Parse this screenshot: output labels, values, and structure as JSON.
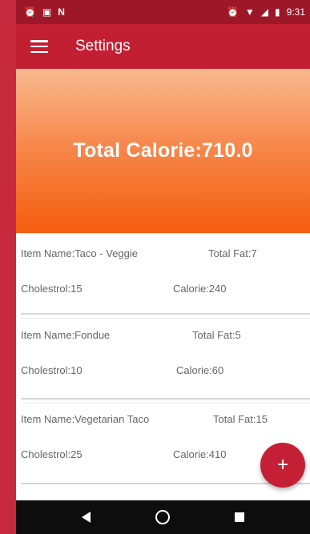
{
  "status_bar": {
    "left_icons": [
      "alarm-icon",
      "image-icon",
      "n-icon"
    ],
    "time": "9:31",
    "right_icons": [
      "alarm-icon",
      "wifi-icon",
      "signal-icon",
      "battery-icon"
    ]
  },
  "app_bar": {
    "title": "Settings",
    "menu_icon": "hamburger-menu-icon",
    "color": "#c31f33"
  },
  "banner": {
    "text": "Total Calorie:710.0",
    "gradient_colors": [
      "#f9b98f",
      "#f7894e",
      "#f45d0e"
    ]
  },
  "items": [
    {
      "name": "Item Name:Taco - Veggie",
      "fat": "Total Fat:7",
      "cholesterol": "Cholestrol:15",
      "calorie": "Calorie:240"
    },
    {
      "name": "Item Name:Fondue",
      "fat": "Total Fat:5",
      "cholesterol": "Cholestrol:10",
      "calorie": "Calorie:60"
    },
    {
      "name": "Item Name:Vegetarian Taco",
      "fat": "Total Fat:15",
      "cholesterol": "Cholestrol:25",
      "calorie": "Calorie:410"
    }
  ],
  "fab": {
    "label": "+",
    "color": "#c51f35"
  },
  "nav_bar": {
    "buttons": [
      "back-icon",
      "home-icon",
      "recents-icon"
    ]
  }
}
